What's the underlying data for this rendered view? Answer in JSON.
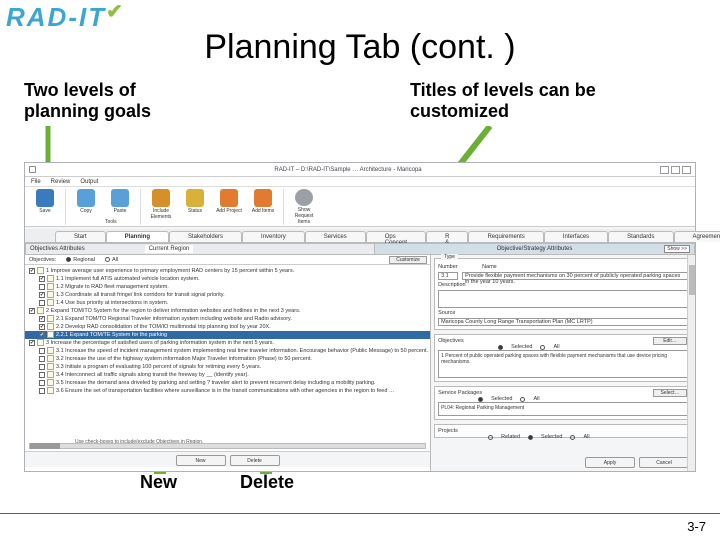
{
  "logo": "RAD-IT",
  "slide_title": "Planning Tab (cont. )",
  "annot": {
    "left": "Two levels of planning goals",
    "right": "Titles of levels can be customized",
    "new": "New",
    "delete": "Delete"
  },
  "app": {
    "window_title": "RAD-IT – D:\\RAD-IT\\Sample … Architecture - Maricopa",
    "menu": [
      "File",
      "Review",
      "Output"
    ],
    "ribbon": [
      {
        "label": "Save",
        "color": "#3a7bbf"
      },
      {
        "label": "Copy",
        "color": "#5aa0d8"
      },
      {
        "label": "Paste",
        "color": "#5aa0d8"
      },
      {
        "label": "Include Elements",
        "color": "#d78f2a"
      },
      {
        "label": "Status",
        "color": "#d9b13a"
      },
      {
        "label": "Add Project",
        "color": "#e07b30"
      },
      {
        "label": "Add Items",
        "color": "#e07b30"
      },
      {
        "label": "Show Request Items",
        "color": "#9aa0a6"
      }
    ],
    "ribbon_group": "Tools",
    "tabs": [
      "Start",
      "Planning",
      "Stakeholders",
      "Inventory",
      "Services",
      "Ops Concept",
      "R & R",
      "Requirements",
      "Interfaces",
      "Standards",
      "Agreements"
    ],
    "active_tab": 1,
    "left_header": "Objectives Attributes",
    "left_highlight_label": "Current Region",
    "right_header": "Objective/Strategy Attributes",
    "right_header_box": "Show >>",
    "objectives_label": "Objectives:",
    "radio_regional": "Regional",
    "radio_all": "All",
    "customize_btn": "Customize",
    "objectives": [
      {
        "lvl": 0,
        "chk": true,
        "text": "1 Improve average user experience to primary employment RAD centers by 15 percent within 5 years."
      },
      {
        "lvl": 1,
        "chk": true,
        "text": "1.1 Implement full ATIS automated vehicle location system."
      },
      {
        "lvl": 1,
        "chk": false,
        "text": "1.2 Migrate to RAD fleet management system."
      },
      {
        "lvl": 1,
        "chk": true,
        "text": "1.3 Coordinate all transit fringe/ link corridors for transit signal priority."
      },
      {
        "lvl": 1,
        "chk": false,
        "text": "1.4 Use bus priority at intersections in system."
      },
      {
        "lvl": 0,
        "chk": true,
        "text": "2 Expand TOM/TO System for the region to deliver information websites and hotlines in the next 3 years."
      },
      {
        "lvl": 1,
        "chk": true,
        "text": "2.1 Expand TOM/TO Regional Traveler information system including website and Radio advisory."
      },
      {
        "lvl": 1,
        "chk": true,
        "text": "2.2 Develop RAD consolidation of the TOM/IO multimodal trip planning tool by year 20X."
      },
      {
        "lvl": 1,
        "chk": true,
        "hl": true,
        "text": "2.2.1 Expand TOM/TE System for the parking"
      },
      {
        "lvl": 0,
        "chk": true,
        "text": "3 Increase the percentage of satisfied users of parking information system in the next 5 years."
      },
      {
        "lvl": 1,
        "chk": false,
        "text": "3.1 Increase the speed of incident management system implementing real time traveler information. Encourage behavior (Public Message) to 50 percent."
      },
      {
        "lvl": 1,
        "chk": false,
        "text": "3.2 Increase the use of the highway system information Major Traveler information (Phase) to 50 percent."
      },
      {
        "lvl": 1,
        "chk": false,
        "text": "3.3 Initiate a program of evaluating 100 percent of signals for retiming every 5 years."
      },
      {
        "lvl": 1,
        "chk": false,
        "text": "3.4 Interconnect all traffic signals along transit the freeway by __ (identify year)."
      },
      {
        "lvl": 1,
        "chk": false,
        "text": "3.5 Increase the demand area driveled by parking and setting ? traveler alert to prevent recurrent delay including a mobility parking."
      },
      {
        "lvl": 1,
        "chk": false,
        "text": "3.6 Ensure the set of transportation facilities where surveillance is in the transit communications with other agencies in the region to feed …"
      }
    ],
    "note": "Use check-boxes to include/exclude Objectives in Region.",
    "new_btn": "New",
    "delete_btn": "Delete",
    "right": {
      "type_label": "Type",
      "number_label": "Number",
      "name_label": "Name",
      "number_value": "3.1",
      "name_value": "Provide flexible payment mechanisms on 30 percent of publicly operated parking spaces in the year 10 years.",
      "desc_label": "Description",
      "source_label": "Source",
      "source_value": "Maricopa County Long Range Transportation Plan (MC LRTP)",
      "objectives_sec": "Objectives",
      "obj_selected": "Selected",
      "obj_all": "All",
      "edit_btn": "Edit…",
      "obj_item": "1 Percent of public operated parking spaces with flexible payment mechanisms that use device pricing mechanisms.",
      "sp_sec": "Service Packages",
      "sp_selected": "Selected",
      "sp_all": "All",
      "select_btn": "Select…",
      "sp_item": "PL04: Regional Parking Management",
      "proj_sec": "Projects",
      "proj_related": "Related",
      "proj_selected": "Selected",
      "proj_all": "All",
      "apply_btn": "Apply",
      "cancel_btn": "Cancel"
    }
  },
  "page_num": "3-7"
}
